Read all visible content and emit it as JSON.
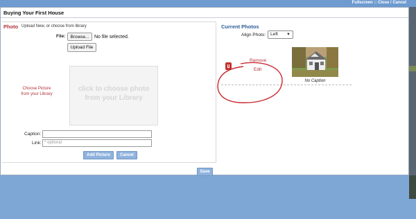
{
  "topbar": {
    "fullscreen_label": "Fullscreen",
    "separator": "::",
    "close_label": "Close / Cancel"
  },
  "dialog": {
    "title": "Buying Your First House",
    "save_label": "Save"
  },
  "photo_section": {
    "title": "Photo",
    "hint": "Upload New, or choose from library",
    "file_label": "File:",
    "browse_label": "Browse...",
    "no_file_text": "No file selected.",
    "upload_label": "Upload File",
    "choose_library_line1": "Choose Picture",
    "choose_library_line2": "from your Library",
    "drop_line1": "click to choose photo",
    "drop_line2": "from your Library",
    "caption_label": "Caption:",
    "caption_value": "",
    "link_label": "Link:",
    "link_placeholder": "* optional",
    "add_picture_label": "Add Picture",
    "cancel_label": "Cancel"
  },
  "current_photos": {
    "title": "Current Photos",
    "align_label": "Align Photo:",
    "align_selected": "Left",
    "items": [
      {
        "remove_label": "Remove",
        "edit_label": "Edit",
        "caption": "No Caption",
        "icon": "delete-icon"
      }
    ]
  },
  "colors": {
    "accent_red": "#b0323a",
    "accent_blue": "#2b5a97",
    "button_blue": "#8fb3dd",
    "background": "#7fa7d6"
  }
}
